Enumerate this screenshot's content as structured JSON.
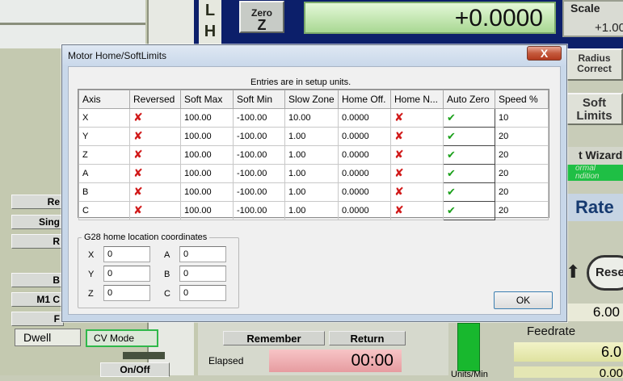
{
  "background": {
    "ref_letters": "L\nH\nO",
    "zero_button": {
      "line1": "Zero",
      "line2": "Z"
    },
    "dro_value": "+0.0000",
    "scale": {
      "label": "Scale",
      "value": "+1.00"
    },
    "radius_correct": "Radius\nCorrect",
    "soft_limits": "Soft\nLimits",
    "wizard": "t Wizard",
    "normal_condition": "ormal\nndition",
    "rate": "Rate",
    "reset": "Rese",
    "value_600": "6.00",
    "feedrate_label": "Feedrate",
    "feed_value": "6.0",
    "feed_value2": "0.00",
    "units_label": "Units/Min",
    "remember": "Remember",
    "return": "Return",
    "elapsed_label": "Elapsed",
    "elapsed_value": "00:00",
    "left_buttons": [
      "Re",
      "Sing",
      "R",
      "B",
      "M1 C",
      "F"
    ],
    "dwell": "Dwell",
    "cv_mode": "CV Mode",
    "on_off": "On/Off"
  },
  "dialog": {
    "title": "Motor Home/SoftLimits",
    "close_glyph": "X",
    "note": "Entries are in setup units.",
    "columns": [
      "Axis",
      "Reversed",
      "Soft Max",
      "Soft Min",
      "Slow Zone",
      "Home Off.",
      "Home N...",
      "Auto Zero",
      "Speed %"
    ],
    "rows": [
      {
        "axis": "X",
        "soft_max": "100.00",
        "soft_min": "-100.00",
        "slow_zone": "10.00",
        "home_off": "0.0000",
        "speed": "10"
      },
      {
        "axis": "Y",
        "soft_max": "100.00",
        "soft_min": "-100.00",
        "slow_zone": "1.00",
        "home_off": "0.0000",
        "speed": "20"
      },
      {
        "axis": "Z",
        "soft_max": "100.00",
        "soft_min": "-100.00",
        "slow_zone": "1.00",
        "home_off": "0.0000",
        "speed": "20"
      },
      {
        "axis": "A",
        "soft_max": "100.00",
        "soft_min": "-100.00",
        "slow_zone": "1.00",
        "home_off": "0.0000",
        "speed": "20"
      },
      {
        "axis": "B",
        "soft_max": "100.00",
        "soft_min": "-100.00",
        "slow_zone": "1.00",
        "home_off": "0.0000",
        "speed": "20"
      },
      {
        "axis": "C",
        "soft_max": "100.00",
        "soft_min": "-100.00",
        "slow_zone": "1.00",
        "home_off": "0.0000",
        "speed": "20"
      }
    ],
    "reversed_icon": "red-x-icon",
    "home_neg_icon": "red-x-icon",
    "auto_zero_icon": "green-check-icon",
    "g28": {
      "title": "G28 home location coordinates",
      "fields": [
        {
          "label": "X",
          "value": "0"
        },
        {
          "label": "Y",
          "value": "0"
        },
        {
          "label": "Z",
          "value": "0"
        },
        {
          "label": "A",
          "value": "0"
        },
        {
          "label": "B",
          "value": "0"
        },
        {
          "label": "C",
          "value": "0"
        }
      ]
    },
    "ok_label": "OK"
  },
  "colors": {
    "red_x": "#d11a1a",
    "green_check": "#1aa01a",
    "dialog_frame": "#c7d6e8"
  }
}
